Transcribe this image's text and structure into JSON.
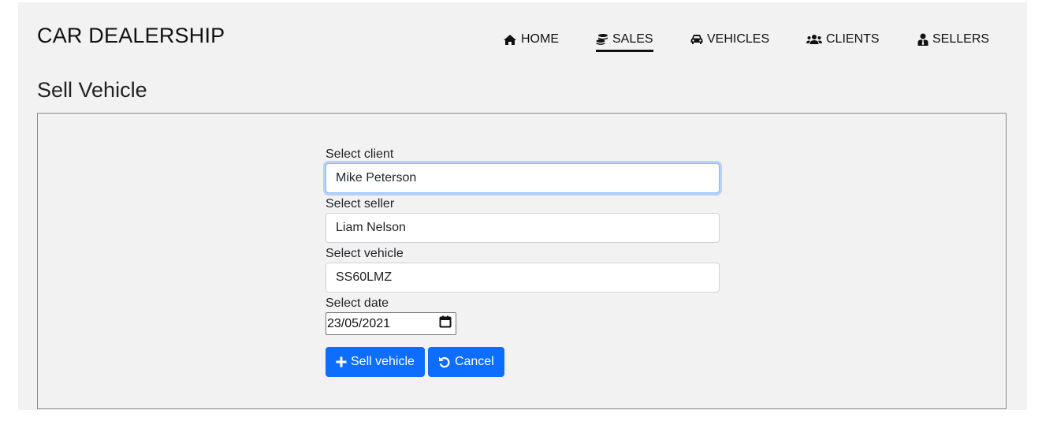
{
  "app": {
    "brand": "CAR DEALERSHIP"
  },
  "nav": {
    "items": [
      {
        "label": "HOME",
        "icon": "home-icon",
        "active": false
      },
      {
        "label": "SALES",
        "icon": "coins-icon",
        "active": true
      },
      {
        "label": "VEHICLES",
        "icon": "car-icon",
        "active": false
      },
      {
        "label": "CLIENTS",
        "icon": "users-icon",
        "active": false
      },
      {
        "label": "SELLERS",
        "icon": "user-tie-icon",
        "active": false
      }
    ]
  },
  "page": {
    "title": "Sell Vehicle"
  },
  "form": {
    "client": {
      "label": "Select client",
      "value": "Mike Peterson"
    },
    "seller": {
      "label": "Select seller",
      "value": "Liam Nelson"
    },
    "vehicle": {
      "label": "Select vehicle",
      "value": "SS60LMZ"
    },
    "date": {
      "label": "Select date",
      "value": "23/05/2021"
    },
    "sell_button": {
      "label": "Sell vehicle",
      "icon": "plus-icon"
    },
    "cancel_button": {
      "label": "Cancel",
      "icon": "undo-icon"
    }
  },
  "colors": {
    "accent": "#0d6efd",
    "background": "#f2f2f2",
    "focus_ring": "#86b7fe"
  }
}
